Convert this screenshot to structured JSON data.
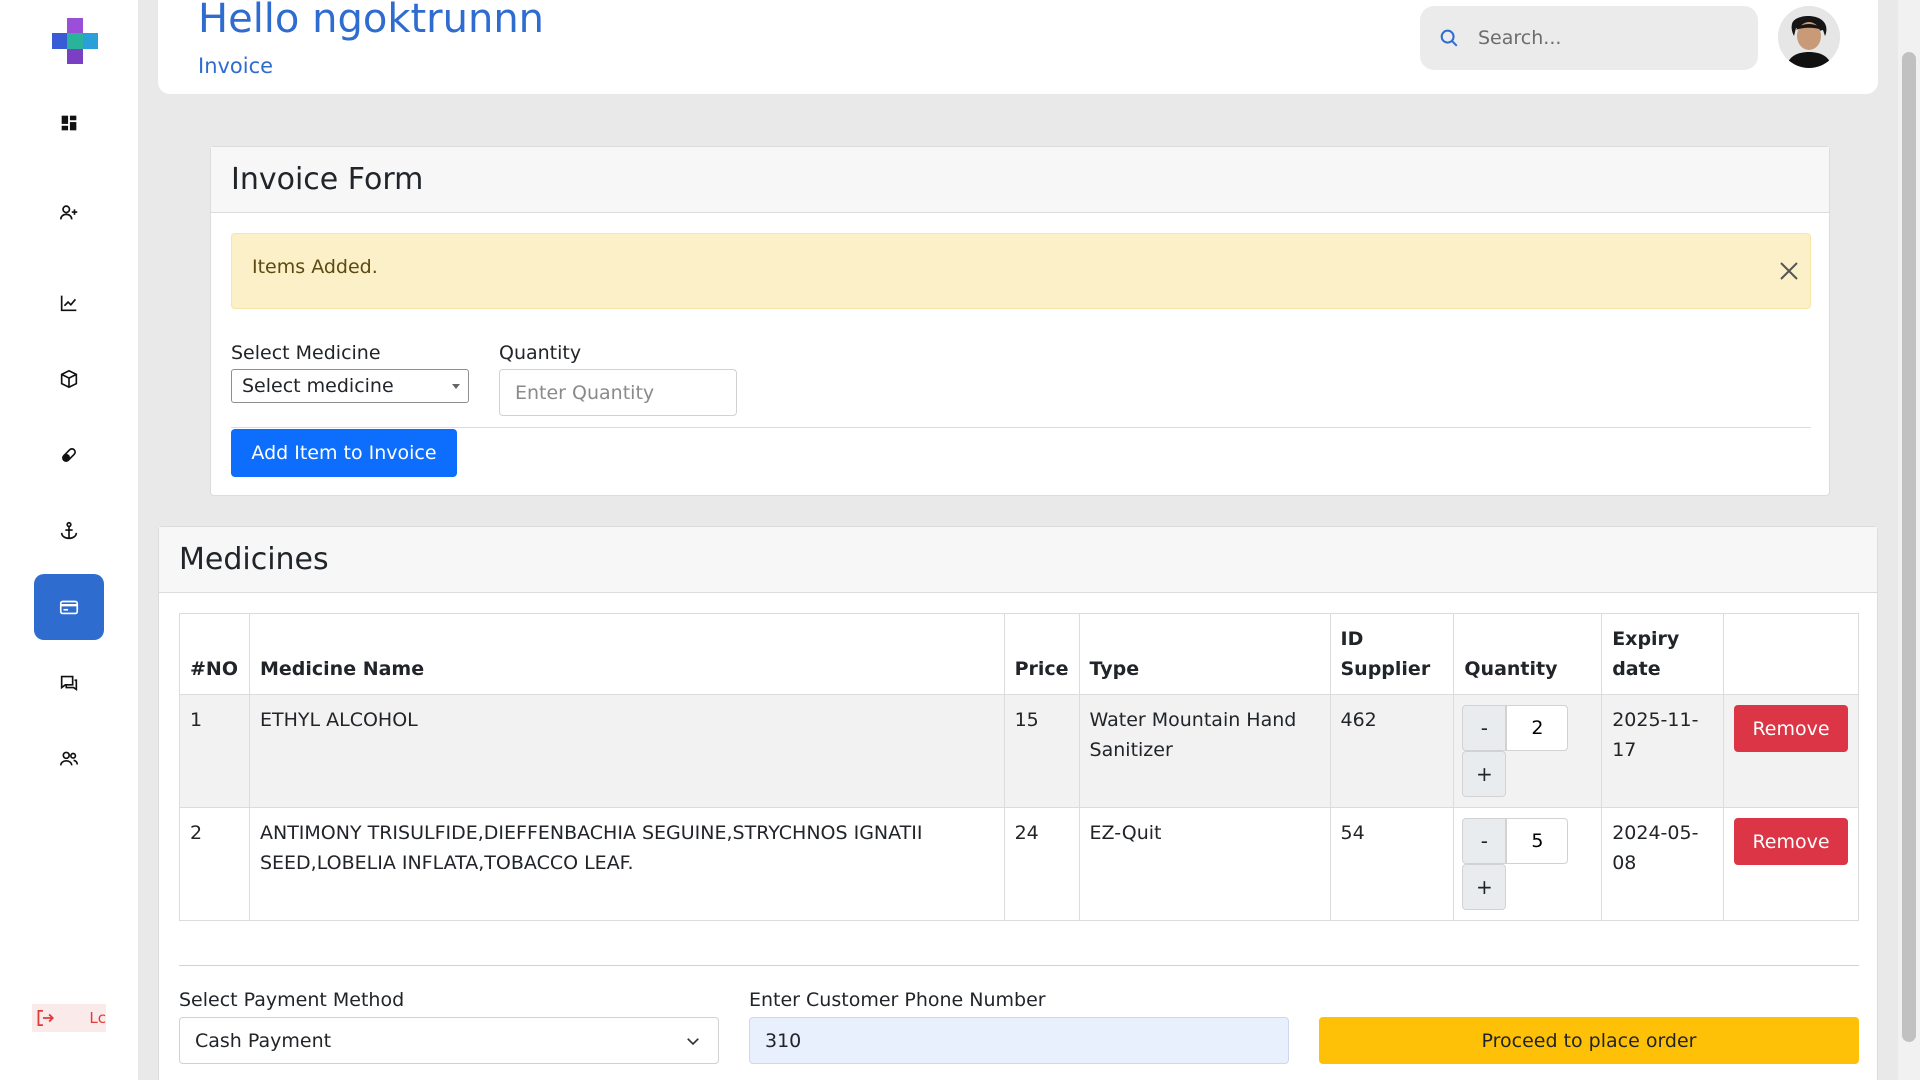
{
  "header": {
    "greeting": "Hello ngoktrunnn",
    "breadcrumb": "Invoice",
    "search_placeholder": "Search..."
  },
  "sidebar": {
    "items": [
      {
        "icon": "dashboard-icon"
      },
      {
        "icon": "add-user-icon"
      },
      {
        "icon": "chart-icon"
      },
      {
        "icon": "box-icon"
      },
      {
        "icon": "pill-icon"
      },
      {
        "icon": "anchor-icon"
      },
      {
        "icon": "card-icon",
        "active": true
      },
      {
        "icon": "chat-icon"
      },
      {
        "icon": "users-icon"
      }
    ],
    "logout_label": "Lc"
  },
  "invoice_form": {
    "title": "Invoice Form",
    "alert": "Items Added.",
    "select_medicine_label": "Select Medicine",
    "select_medicine_value": "Select medicine",
    "quantity_label": "Quantity",
    "quantity_placeholder": "Enter Quantity",
    "add_button": "Add Item to Invoice"
  },
  "medicines": {
    "title": "Medicines",
    "columns": [
      "#NO",
      "Medicine Name",
      "Price",
      "Type",
      "ID Supplier",
      "Quantity",
      "Expiry date",
      ""
    ],
    "rows": [
      {
        "no": "1",
        "name": "ETHYL ALCOHOL",
        "price": "15",
        "type": "Water Mountain Hand Sanitizer",
        "supplier": "462",
        "quantity": "2",
        "expiry": "2025-11-17"
      },
      {
        "no": "2",
        "name": "ANTIMONY TRISULFIDE,DIEFFENBACHIA SEGUINE,STRYCHNOS IGNATII SEED,LOBELIA INFLATA,TOBACCO LEAF.",
        "price": "24",
        "type": "EZ-Quit",
        "supplier": "54",
        "quantity": "5",
        "expiry": "2024-05-08"
      }
    ],
    "minus_label": "-",
    "plus_label": "+",
    "remove_label": "Remove"
  },
  "checkout": {
    "payment_label": "Select Payment Method",
    "payment_value": "Cash Payment",
    "phone_label": "Enter Customer Phone Number",
    "phone_value": "310",
    "proceed_label": "Proceed to place order"
  },
  "colors": {
    "primary": "#2f6ccf",
    "button_blue": "#0d6efd",
    "danger": "#dc3545",
    "warning": "#ffc107",
    "alert_bg": "#fbf0c8"
  }
}
